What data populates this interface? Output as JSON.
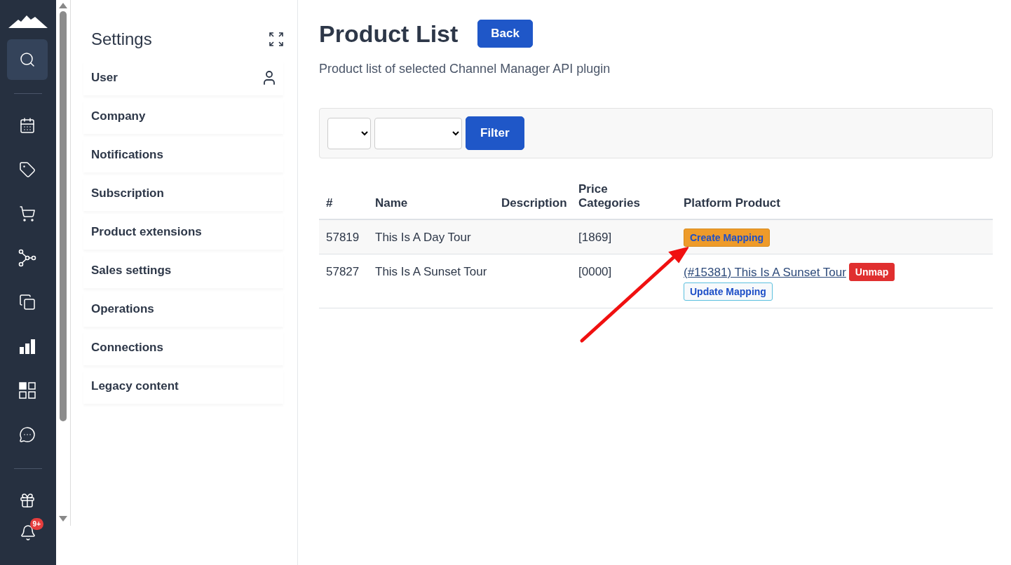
{
  "nav": {
    "groups": [
      [
        {
          "kind": "search",
          "selected": true
        }
      ],
      [
        {
          "kind": "calendar",
          "selected": false
        },
        {
          "kind": "tag",
          "selected": false
        },
        {
          "kind": "cart",
          "selected": false
        },
        {
          "kind": "network",
          "selected": false
        },
        {
          "kind": "copy",
          "selected": false
        },
        {
          "kind": "chart",
          "selected": false
        },
        {
          "kind": "grid",
          "selected": false
        },
        {
          "kind": "chat",
          "selected": false
        }
      ],
      [
        {
          "kind": "gift",
          "selected": false
        }
      ]
    ],
    "notifications": {
      "badge": "9+"
    }
  },
  "settings": {
    "title": "Settings",
    "items": [
      {
        "label": "User",
        "icon": true
      },
      {
        "label": "Company",
        "icon": false
      },
      {
        "label": "Notifications",
        "icon": false
      },
      {
        "label": "Subscription",
        "icon": false
      },
      {
        "label": "Product extensions",
        "icon": false
      },
      {
        "label": "Sales settings",
        "icon": false
      },
      {
        "label": "Operations",
        "icon": false
      },
      {
        "label": "Connections",
        "icon": false
      },
      {
        "label": "Legacy content",
        "icon": false
      }
    ]
  },
  "page": {
    "title": "Product List",
    "back": "Back",
    "subtitle": "Product list of selected Channel Manager API plugin"
  },
  "filter": {
    "button": "Filter"
  },
  "table": {
    "columns": [
      "#",
      "Name",
      "Description",
      "Price Categories",
      "Platform Product"
    ],
    "rows": [
      {
        "id": "57819",
        "name": "This Is A Day Tour",
        "description": "",
        "price": "[1869]",
        "platform": {
          "kind": "unmapped",
          "button": "Create Mapping"
        }
      },
      {
        "id": "57827",
        "name": "This Is A Sunset Tour",
        "description": "",
        "price": "[0000]",
        "platform": {
          "kind": "mapped",
          "link": "(#15381) This Is A Sunset Tour",
          "unmap": "Unmap",
          "button": "Update Mapping"
        }
      }
    ]
  }
}
